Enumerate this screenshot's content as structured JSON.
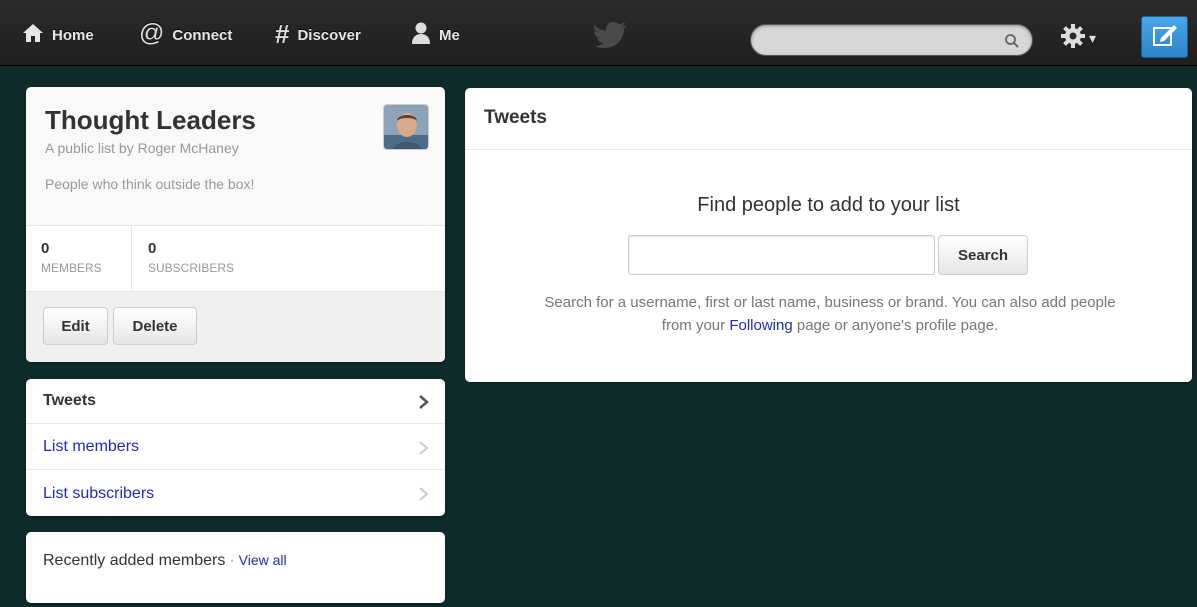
{
  "topnav": {
    "home": "Home",
    "connect": "Connect",
    "discover": "Discover",
    "me": "Me",
    "search_placeholder": ""
  },
  "list": {
    "title": "Thought Leaders",
    "byline": "A public list by Roger McHaney",
    "description": "People who think outside the box!",
    "members_count": "0",
    "members_label": "MEMBERS",
    "subscribers_count": "0",
    "subscribers_label": "SUBSCRIBERS",
    "edit_label": "Edit",
    "delete_label": "Delete"
  },
  "sidenav": {
    "items": [
      {
        "label": "Tweets"
      },
      {
        "label": "List members"
      },
      {
        "label": "List subscribers"
      }
    ]
  },
  "recent": {
    "label": "Recently added members",
    "separator": "·",
    "view_all": "View all"
  },
  "tweets": {
    "title": "Tweets",
    "find_title": "Find people to add to your list",
    "search_button": "Search",
    "hint_before": "Search for a username, first or last name, business or brand. You can also add people from your ",
    "hint_link": "Following",
    "hint_after": " page or anyone's profile page."
  },
  "colors": {
    "background": "#0e2a29",
    "link": "#1f2bbf",
    "compose": "#3a95da"
  }
}
